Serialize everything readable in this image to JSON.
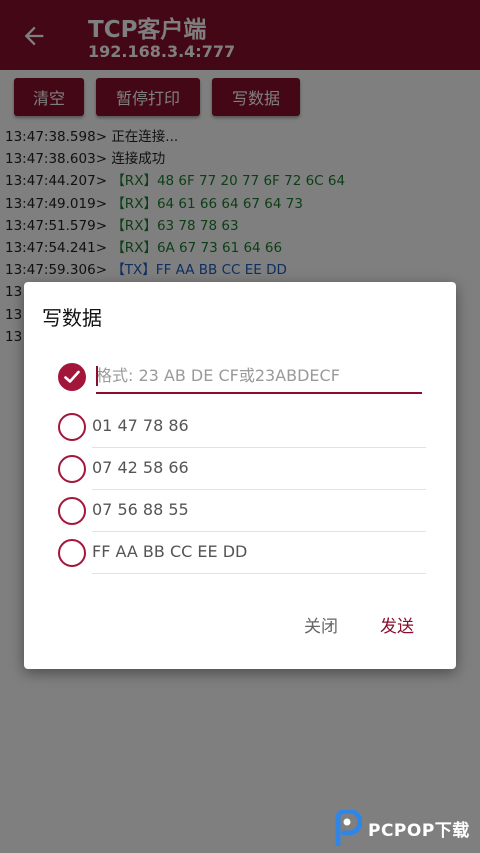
{
  "appbar": {
    "title": "TCP客户端",
    "subtitle": "192.168.3.4:777",
    "back_icon": "arrow-left-icon"
  },
  "toolbar": {
    "clear_label": "清空",
    "pause_label": "暂停打印",
    "write_label": "写数据"
  },
  "log": [
    {
      "ts": "13:47:38.598>",
      "msg": "正在连接...",
      "kind": "plain"
    },
    {
      "ts": "13:47:38.603>",
      "msg": "连接成功",
      "kind": "plain"
    },
    {
      "ts": "13:47:44.207>",
      "msg": "【RX】48 6F 77 20 77 6F 72 6C 64",
      "kind": "rx"
    },
    {
      "ts": "13:47:49.019>",
      "msg": "【RX】64 61 66 64 67 64 73",
      "kind": "rx"
    },
    {
      "ts": "13:47:51.579>",
      "msg": "【RX】63 78 78 63",
      "kind": "rx"
    },
    {
      "ts": "13:47:54.241>",
      "msg": "【RX】6A 67 73 61 64 66",
      "kind": "rx"
    },
    {
      "ts": "13:47:59.306>",
      "msg": "【TX】FF AA BB CC EE DD",
      "kind": "tx"
    },
    {
      "ts": "13",
      "msg": "",
      "kind": "plain"
    },
    {
      "ts": "13",
      "msg": "",
      "kind": "plain"
    },
    {
      "ts": "13",
      "msg": "",
      "kind": "plain"
    }
  ],
  "dialog": {
    "title": "写数据",
    "input_placeholder": "格式: 23 AB DE CF或23ABDECF",
    "input_value": "",
    "options": [
      "01 47 78 86",
      "07 42 58 66",
      "07 56 88 55",
      "FF AA BB CC EE DD"
    ],
    "close_label": "关闭",
    "send_label": "发送"
  },
  "watermark": {
    "text": "PCPOP下载"
  },
  "colors": {
    "primary": "#880e2c",
    "rx": "#1a7f2e",
    "tx": "#1f5fbf"
  }
}
